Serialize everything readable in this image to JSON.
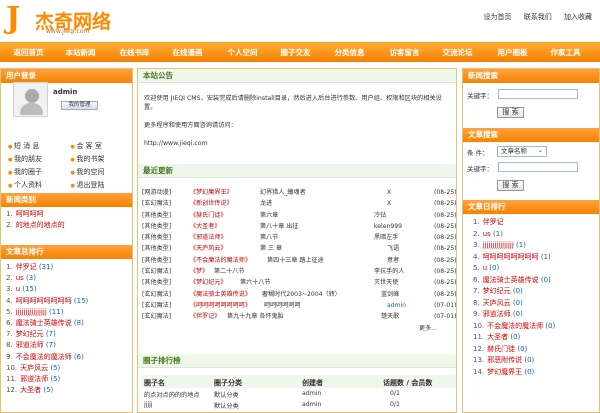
{
  "brand": {
    "name": "杰奇网络",
    "url": "www.jieqi.com",
    "mark": "J"
  },
  "top_links": [
    "设为首页",
    "联系我们",
    "加入收藏"
  ],
  "nav": [
    "返回首页",
    "本站新闻",
    "在线书库",
    "在线漫画",
    "个人空间",
    "圈子交友",
    "分类信息",
    "访客留言",
    "交流论坛",
    "用户图板",
    "作家工具"
  ],
  "left": {
    "login_title": "用户登录",
    "username": "admin",
    "manage_button": "我的管理",
    "menu": [
      "短 消 息",
      "会 客 室",
      "我的朋友",
      "我的书架",
      "我的圈子",
      "我的空间",
      "个人资料",
      "退出登陆"
    ],
    "news_title": "新闻类别",
    "news_items": [
      "呵呵呵呵",
      "的地点的地点的"
    ],
    "rank_title": "文章总排行",
    "rank_items": [
      "伴罗记",
      "us",
      "u",
      "呵呵呵呵呵呵呵呵",
      "jjjjjjjjjjjjjjjj",
      "魔法骑士英雄传说",
      "梦幻纪元",
      "邪道法师",
      "不会魔法的魔法师",
      "天庐风云",
      "邪道法师",
      "大圣者"
    ]
  },
  "center": {
    "notice_title": "本站公告",
    "notice_lines": [
      "欢迎使用 JIEQI CMS，安装完成后请删除install目录，然后进入后台进行参数、用户组、权限和区块的相关设置。",
      "更多程序和使用方面咨询请访问：",
      "http://www.jieqi.com"
    ],
    "recent_title": "最近更新",
    "recent": [
      [
        "[网游动漫]",
        "《梦幻魔界王》",
        "幻界猎人_蠟魂者",
        "X",
        "(08-25)"
      ],
      [
        "[玄幻魔法]",
        "《新创世传说》",
        "龙进",
        "X",
        "(08-25)"
      ],
      [
        "[其他类型]",
        "《赫氏门徒》",
        "第六章",
        "冷钻",
        "(08-25)"
      ],
      [
        "[其他类型]",
        "《大圣者》",
        "第八十章 出征",
        "kelen999",
        "(08-25)"
      ],
      [
        "[其他类型]",
        "《邪道法师》",
        "第八节",
        "黑暗左手",
        "(08-25)"
      ],
      [
        "[其他类型]",
        "《天庐风云》",
        "第 三 章",
        "飞语",
        "(08-25)"
      ],
      [
        "[其他类型]",
        "《不会魔法的魔法师》",
        "第四十三章 踏上征途",
        "意者",
        "(08-25)"
      ],
      [
        "[玄幻魔法]",
        "《梦》",
        "第二十八节",
        "李抗手的人",
        "(08-25)"
      ],
      [
        "[其他类型]",
        "《梦幻纪元》",
        "第六十八节",
        "灭世天使",
        "(08-25)"
      ],
      [
        "[玄幻魔法]",
        "《魔法骑士英雄传说》",
        "奢糊时代2003~2004（转）",
        "蓝剑峰",
        "(08-25)"
      ],
      [
        "[玄幻魔法]",
        "《呵呵呵呵呵呵呵呵》",
        "呵呵呵呵呵呵",
        "admin",
        "(07-01)"
      ],
      [
        "[玄幻魔法]",
        "《伴罗记》",
        "第九十九章 各怀鬼胎",
        "楚天歌",
        "(07-01)"
      ]
    ],
    "more": "更多...",
    "circle_title": "圈子排行榜",
    "table_headers": [
      "圈子名",
      "圈子分类",
      "创建者",
      "话题数 / 会员数"
    ],
    "table_rows": [
      [
        "的点对点的的的地点",
        "默认分类",
        "admin",
        "0/1"
      ],
      [
        "jjjjj",
        "默认分类",
        "admin",
        "0/1"
      ]
    ]
  },
  "right": {
    "news_search": "新闻搜索",
    "keyword_label": "关键字：",
    "search_button": "搜 索",
    "article_search": "文章搜索",
    "condition_label": "条 件：",
    "condition_value": "文章名称",
    "day_rank": "文章日排行",
    "day_items": [
      "伴罗记",
      "us",
      "jjjjjjjjjjjjjjjj",
      "呵呵呵呵呵呵呵呵",
      "u",
      "魔法骑士英雄传说",
      "梦幻纪元",
      "天庐风云",
      "邪道法师",
      "不会魔法的魔法师",
      "大圣者",
      "赫氏门徒",
      "邪恶附传说",
      "梦幻魔界王"
    ]
  }
}
